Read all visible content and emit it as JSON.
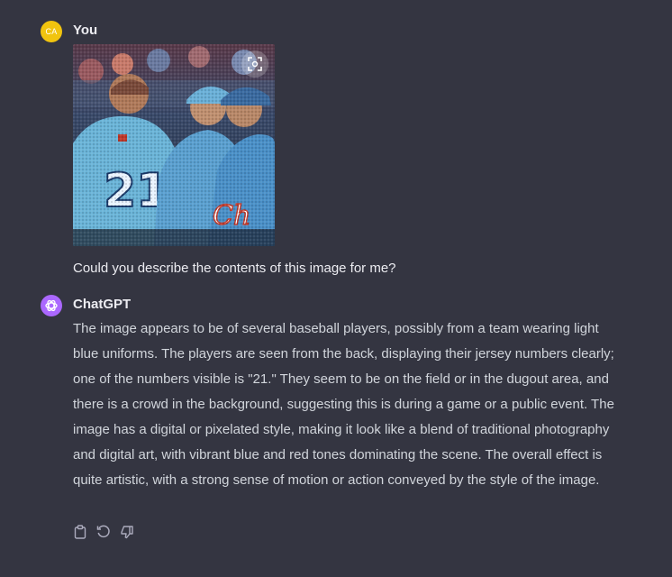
{
  "user": {
    "initials": "CA",
    "name": "You",
    "message": "Could you describe the contents of this image for me?"
  },
  "assistant": {
    "name": "ChatGPT",
    "message": "The image appears to be of several baseball players, possibly from a team wearing light blue uniforms. The players are seen from the back, displaying their jersey numbers clearly; one of the numbers visible is \"21.\" They seem to be on the field or in the dugout area, and there is a crowd in the background, suggesting this is during a game or a public event. The image has a digital or pixelated style, making it look like a blend of traditional photography and digital art, with vibrant blue and red tones dominating the scene. The overall effect is quite artistic, with a strong sense of motion or action conveyed by the style of the image."
  },
  "image": {
    "jersey_number": "21",
    "jersey_script": "Ch"
  },
  "icons": {
    "expand": "expand-image-icon",
    "copy": "clipboard-icon",
    "regenerate": "regenerate-icon",
    "dislike": "thumbs-down-icon",
    "assistant_logo": "openai-logo-icon"
  },
  "colors": {
    "background": "#343541",
    "user_avatar": "#f1c40f",
    "assistant_avatar": "#ab68ff",
    "text": "#ececf1",
    "body_text": "#d1d5db",
    "icon": "#acacbe"
  }
}
